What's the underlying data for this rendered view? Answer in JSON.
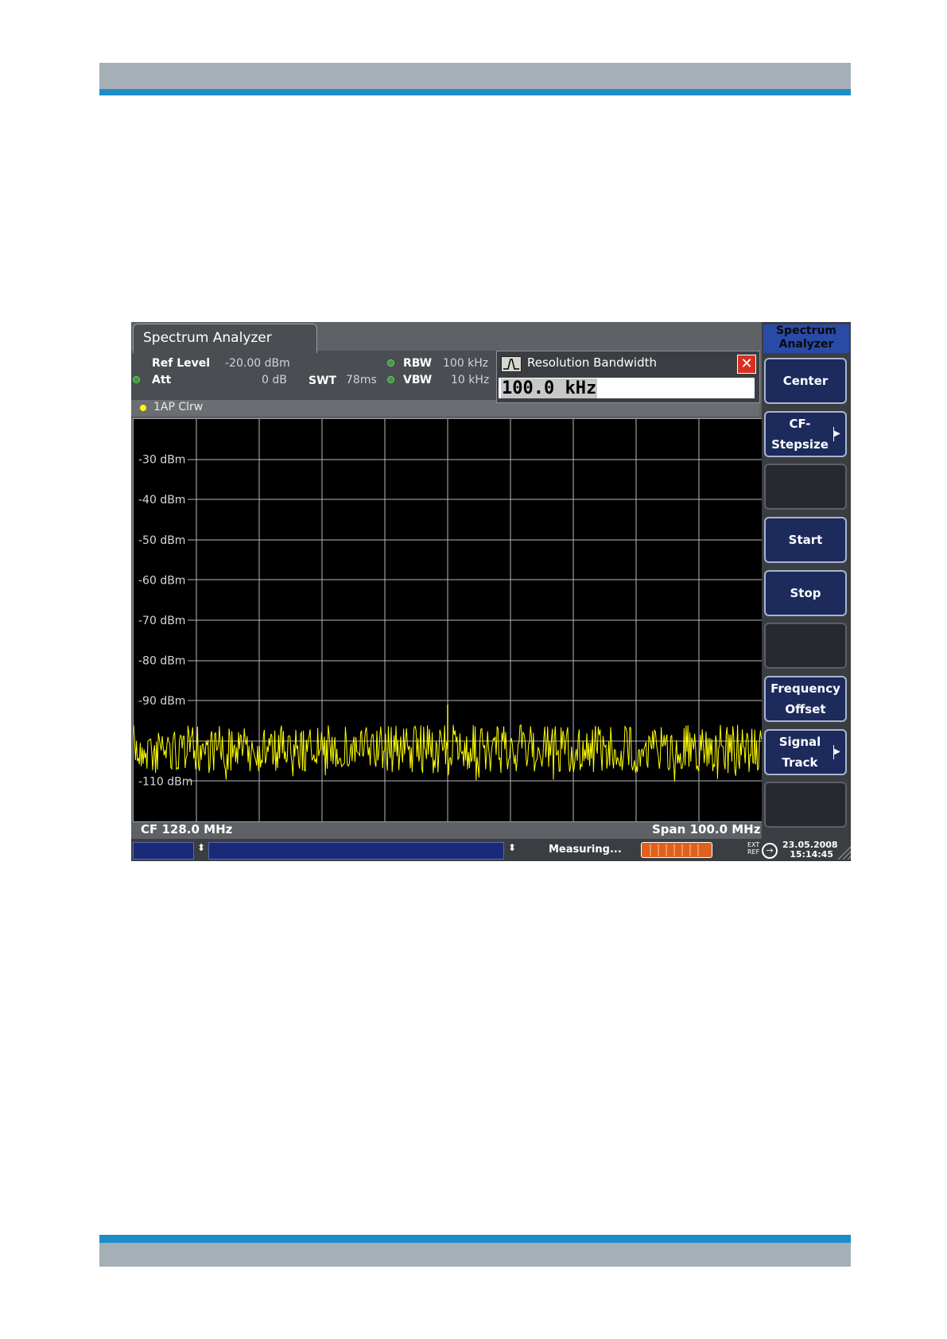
{
  "screen": {
    "tab_title": "Spectrum Analyzer",
    "header": {
      "ref_level_label": "Ref Level",
      "ref_level_value": "-20.00 dBm",
      "att_label": "Att",
      "att_value": "0 dB",
      "swt_label": "SWT",
      "swt_value": "78ms",
      "rbw_label": "RBW",
      "rbw_value": "100 kHz",
      "vbw_label": "VBW",
      "vbw_value": "10 kHz"
    },
    "trace_label": "1AP Clrw",
    "dialog": {
      "title": "Resolution Bandwidth",
      "value": "100.0 kHz",
      "close": "✕"
    },
    "plot": {
      "y_ticks": [
        "-30 dBm",
        "-40 dBm",
        "-50 dBm",
        "-60 dBm",
        "-70 dBm",
        "-80 dBm",
        "-90 dBm",
        "-110 dBm"
      ],
      "center_freq": "CF 128.0 MHz",
      "span": "Span 100.0 MHz",
      "trace_color": "#ffff00",
      "grid_color": "#b8b8b8"
    },
    "status": {
      "measuring": "Measuring...",
      "ext_ref": [
        "EXT",
        "REF"
      ],
      "date": "23.05.2008",
      "time": "15:14:45"
    },
    "softkeys": {
      "title_line1": "Spectrum",
      "title_line2": "Analyzer",
      "center": "Center",
      "cf_stepsize_1": "CF-",
      "cf_stepsize_2": "Stepsize",
      "start": "Start",
      "stop": "Stop",
      "freq_offset_1": "Frequency",
      "freq_offset_2": "Offset",
      "signal_track_1": "Signal",
      "signal_track_2": "Track"
    }
  }
}
